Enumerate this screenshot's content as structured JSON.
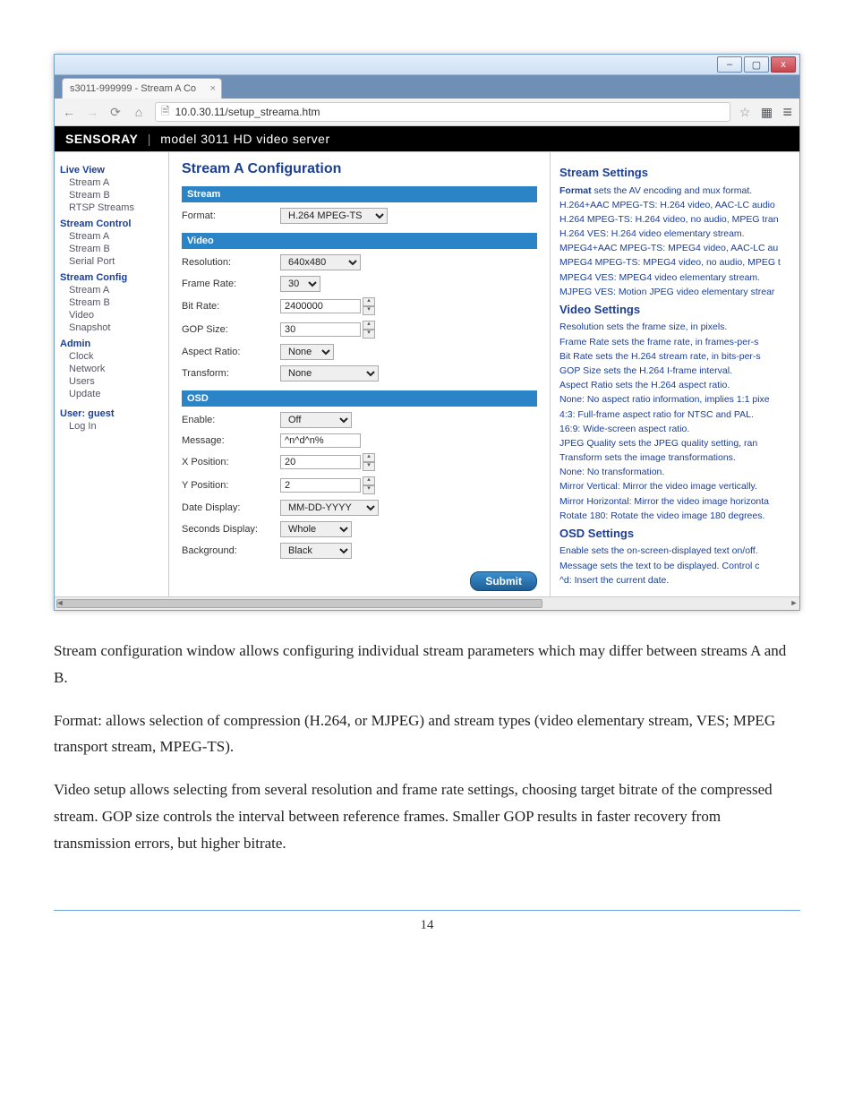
{
  "window": {
    "tab_title": "s3011-999999 - Stream A Co",
    "url": "10.0.30.11/setup_streama.htm",
    "minimize": "–",
    "maximize": "▢",
    "close": "x"
  },
  "banner": {
    "brand": "SENSORAY",
    "model": "model 3011 HD video server"
  },
  "sidebar": {
    "sections": [
      {
        "head": "Live View",
        "items": [
          "Stream A",
          "Stream B",
          "RTSP Streams"
        ]
      },
      {
        "head": "Stream Control",
        "items": [
          "Stream A",
          "Stream B",
          "Serial Port"
        ]
      },
      {
        "head": "Stream Config",
        "items": [
          "Stream A",
          "Stream B",
          "Video",
          "Snapshot"
        ]
      },
      {
        "head": "Admin",
        "items": [
          "Clock",
          "Network",
          "Users",
          "Update"
        ]
      }
    ],
    "user_label": "User: guest",
    "login": "Log In"
  },
  "center": {
    "title": "Stream A Configuration",
    "sections": {
      "stream": "Stream",
      "video": "Video",
      "osd": "OSD"
    },
    "fields": {
      "format": {
        "label": "Format:",
        "value": "H.264 MPEG-TS"
      },
      "resolution": {
        "label": "Resolution:",
        "value": "640x480"
      },
      "frame_rate": {
        "label": "Frame Rate:",
        "value": "30"
      },
      "bit_rate": {
        "label": "Bit Rate:",
        "value": "2400000"
      },
      "gop_size": {
        "label": "GOP Size:",
        "value": "30"
      },
      "aspect_ratio": {
        "label": "Aspect Ratio:",
        "value": "None"
      },
      "transform": {
        "label": "Transform:",
        "value": "None"
      },
      "osd_enable": {
        "label": "Enable:",
        "value": "Off"
      },
      "osd_message": {
        "label": "Message:",
        "value": "^n^d^n%"
      },
      "osd_xpos": {
        "label": "X Position:",
        "value": "20"
      },
      "osd_ypos": {
        "label": "Y Position:",
        "value": "2"
      },
      "date_display": {
        "label": "Date Display:",
        "value": "MM-DD-YYYY"
      },
      "seconds_display": {
        "label": "Seconds Display:",
        "value": "Whole"
      },
      "background": {
        "label": "Background:",
        "value": "Black"
      }
    },
    "submit": "Submit"
  },
  "help": {
    "h1": "Stream Settings",
    "l_format": "Format sets the AV encoding and mux format.",
    "l_h264aac": "H.264+AAC MPEG-TS: H.264 video, AAC-LC audio",
    "l_h264ts": "H.264 MPEG-TS: H.264 video, no audio, MPEG tran",
    "l_h264ves": "H.264 VES: H.264 video elementary stream.",
    "l_mp4aac": "MPEG4+AAC MPEG-TS: MPEG4 video, AAC-LC au",
    "l_mp4ts": "MPEG4 MPEG-TS: MPEG4 video, no audio, MPEG t",
    "l_mp4ves": "MPEG4 VES: MPEG4 video elementary stream.",
    "l_mjpeg": "MJPEG VES: Motion JPEG video elementary strear",
    "h2": "Video Settings",
    "l_res": "Resolution sets the frame size, in pixels.",
    "l_fr": "Frame Rate sets the frame rate, in frames-per-s",
    "l_br": "Bit Rate sets the H.264 stream rate, in bits-per-s",
    "l_gop": "GOP Size sets the H.264 I-frame interval.",
    "l_ar": "Aspect Ratio sets the H.264 aspect ratio.",
    "l_none": "None: No aspect ratio information, implies 1:1 pixe",
    "l_43": "4:3: Full-frame aspect ratio for NTSC and PAL.",
    "l_169": "16:9: Wide-screen aspect ratio.",
    "l_jpegq": "JPEG Quality sets the JPEG quality setting, ran",
    "l_tr": "Transform sets the image transformations.",
    "l_tnone": "None: No transformation.",
    "l_mv": "Mirror Vertical: Mirror the video image vertically.",
    "l_mh": "Mirror Horizontal: Mirror the video image horizonta",
    "l_r180": "Rotate 180: Rotate the video image 180 degrees.",
    "h3": "OSD Settings",
    "l_en": "Enable sets the on-screen-displayed text on/off.",
    "l_msg": "Message sets the text to be displayed. Control c",
    "l_d": "^d: Insert the current date."
  },
  "body": {
    "p1": "Stream configuration window allows configuring individual stream parameters which may differ between streams A and B.",
    "p2": "Format: allows selection of compression (H.264,  or MJPEG) and stream types (video elementary stream, VES; MPEG transport stream, MPEG-TS).",
    "p3": "Video setup allows selecting from several resolution and frame rate settings, choosing target bitrate of the compressed stream. GOP size controls the interval between reference frames. Smaller GOP results in faster recovery from transmission errors, but higher bitrate."
  },
  "page_number": "14"
}
